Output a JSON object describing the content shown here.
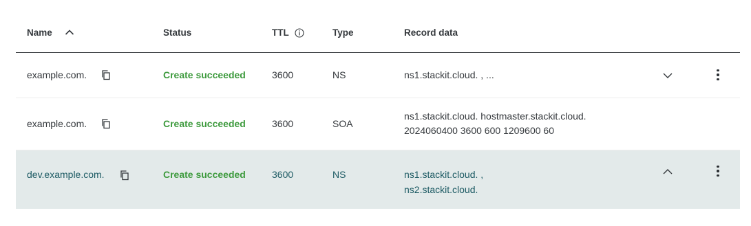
{
  "header": {
    "name": "Name",
    "status": "Status",
    "ttl": "TTL",
    "type": "Type",
    "record_data": "Record data"
  },
  "rows": [
    {
      "name": "example.com.",
      "status": "Create succeeded",
      "ttl": "3600",
      "type": "NS",
      "record_line1": "ns1.stackit.cloud. , ...",
      "record_line2": "",
      "expander": "chevron-down-icon"
    },
    {
      "name": "example.com.",
      "status": "Create succeeded",
      "ttl": "3600",
      "type": "SOA",
      "record_line1": "ns1.stackit.cloud. hostmaster.stackit.cloud.",
      "record_line2": "2024060400 3600 600 1209600 60"
    },
    {
      "name": "dev.example.com.",
      "status": "Create succeeded",
      "ttl": "3600",
      "type": "NS",
      "record_line1": "ns1.stackit.cloud. ,",
      "record_line2": "ns2.stackit.cloud.",
      "expander": "chevron-up-icon"
    }
  ],
  "colors": {
    "status_success": "#3d9a3d",
    "selected_row_bg": "#e3eaea",
    "selected_row_text": "#1c5a63"
  },
  "icons": [
    "chevron-up-icon",
    "info-icon",
    "copy-icon",
    "chevron-down-icon",
    "kebab-menu-icon"
  ]
}
